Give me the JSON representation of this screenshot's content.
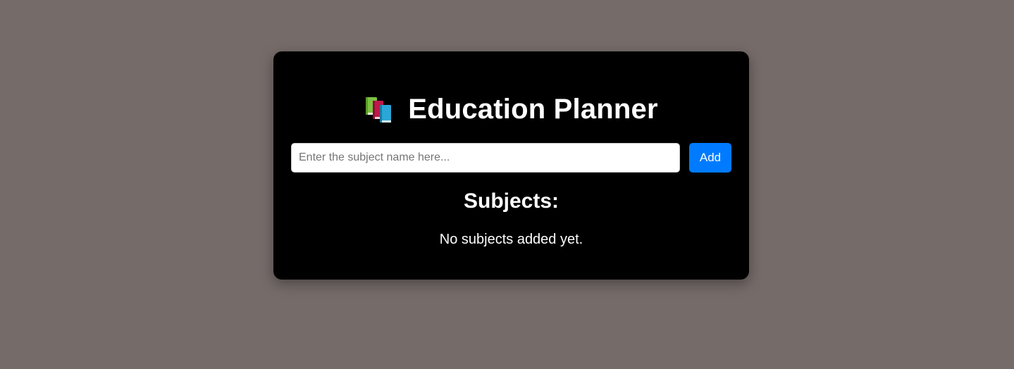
{
  "app": {
    "title": "Education Planner",
    "title_icon": "books-icon"
  },
  "form": {
    "input_value": "",
    "input_placeholder": "Enter the subject name here...",
    "add_label": "Add"
  },
  "subjects": {
    "heading": "Subjects:",
    "items": [],
    "empty_message": "No subjects added yet."
  },
  "colors": {
    "page_background": "#756b69",
    "card_background": "#000000",
    "accent": "#007bff",
    "text": "#ffffff"
  }
}
